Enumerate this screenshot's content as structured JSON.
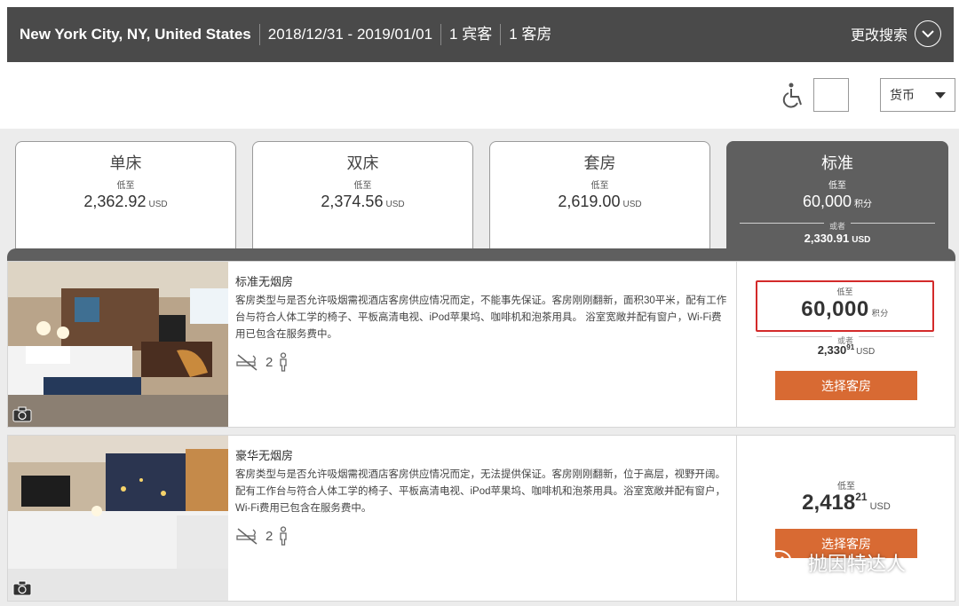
{
  "search": {
    "location": "New York City, NY, United States",
    "dates": "2018/12/31 - 2019/01/01",
    "guests": "1 宾客",
    "rooms": "1 客房",
    "modify_label": "更改搜索"
  },
  "tools": {
    "currency_label": "货币"
  },
  "tabs": [
    {
      "title": "单床",
      "from": "低至",
      "price": "2,362.92",
      "unit": "USD"
    },
    {
      "title": "双床",
      "from": "低至",
      "price": "2,374.56",
      "unit": "USD"
    },
    {
      "title": "套房",
      "from": "低至",
      "price": "2,619.00",
      "unit": "USD"
    },
    {
      "title": "标准",
      "from": "低至",
      "price": "60,000",
      "unit": "积分",
      "or": "或者",
      "cash": "2,330.91",
      "cash_unit": "USD"
    }
  ],
  "rooms": [
    {
      "name": "标准无烟房",
      "desc": "客房类型与是否允许吸烟需视酒店客房供应情况而定，不能事先保证。客房刚刚翻新，面积30平米，配有工作台与符合人体工学的椅子、平板高清电视、iPod苹果坞、咖啡机和泡茶用具。 浴室宽敞并配有窗户，Wi-Fi费用已包含在服务费中。",
      "occupancy": "2",
      "from": "低至",
      "points": "60,000",
      "points_unit": "积分",
      "or": "或者",
      "cash_main": "2,330",
      "cash_cents": "91",
      "cash_unit": "USD",
      "button": "选择客房"
    },
    {
      "name": "豪华无烟房",
      "desc": "客房类型与是否允许吸烟需视酒店客房供应情况而定，无法提供保证。客房刚刚翻新，位于高层，视野开阔。配有工作台与符合人体工学的椅子、平板高清电视、iPod苹果坞、咖啡机和泡茶用具。浴室宽敞并配有窗户，Wi-Fi费用已包含在服务费中。",
      "occupancy": "2",
      "from": "低至",
      "price_main": "2,418",
      "price_cents": "21",
      "price_unit": "USD",
      "button": "选择客房"
    }
  ],
  "watermark": "抛因特达人",
  "colors": {
    "header_bg": "#4a4a4a",
    "active_tab": "#5f5f5f",
    "button": "#d86a33",
    "highlight_border": "#d32a2a"
  }
}
